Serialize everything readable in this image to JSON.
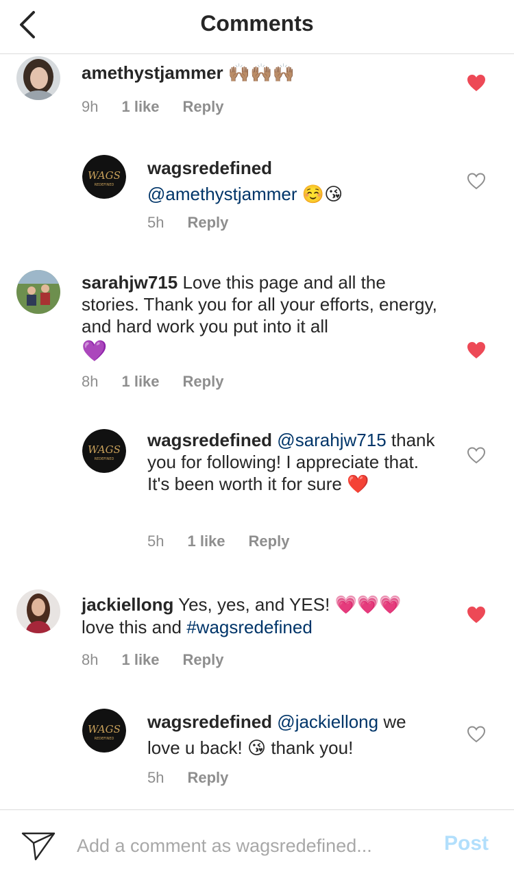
{
  "header": {
    "title": "Comments",
    "back_icon": "chevron-left-icon"
  },
  "comments": [
    {
      "username": "amethystjammer",
      "text": "",
      "emoji_suffix": "🙌🏽🙌🏽🙌🏽",
      "time": "9h",
      "likes": "1 like",
      "reply": "Reply",
      "liked": true
    },
    {
      "username": "wagsredefined",
      "mention": "@amethystjammer",
      "emoji_suffix": "☺️😘",
      "time": "5h",
      "likes": "",
      "reply": "Reply",
      "liked": false
    },
    {
      "username": "sarahjw715",
      "text": " Love this page and all the stories. Thank you for all your efforts, energy, and hard work you put into it all",
      "emoji_suffix": "💜",
      "time": "8h",
      "likes": "1 like",
      "reply": "Reply",
      "liked": true
    },
    {
      "username": "wagsredefined",
      "mention": "@sarahjw715",
      "text": " thank you for following! I appreciate that. It's been worth it for sure",
      "emoji_suffix": "❤️",
      "time": "5h",
      "likes": "1 like",
      "reply": "Reply",
      "liked": false
    },
    {
      "username": "jackiellong",
      "text": " Yes, yes, and YES!",
      "emoji_suffix": "💗💗💗",
      "text2": "love this and ",
      "hashtag": "#wagsredefined",
      "time": "8h",
      "likes": "1 like",
      "reply": "Reply",
      "liked": true
    },
    {
      "username": "wagsredefined",
      "mention": "@jackiellong",
      "text": " we love u back!",
      "emoji_suffix": "😘",
      "text2": " thank you!",
      "time": "5h",
      "likes": "",
      "reply": "Reply",
      "liked": false
    }
  ],
  "composer": {
    "placeholder": "Add a comment as wagsredefined...",
    "post_label": "Post",
    "send_icon": "paper-plane-icon"
  },
  "logo_text": {
    "main": "WAGS",
    "sub": "REDEFINED"
  },
  "colors": {
    "heart_filled": "#ed4956",
    "mention": "#003569",
    "meta": "#8e8e8e",
    "post_disabled": "#b2dffc"
  }
}
